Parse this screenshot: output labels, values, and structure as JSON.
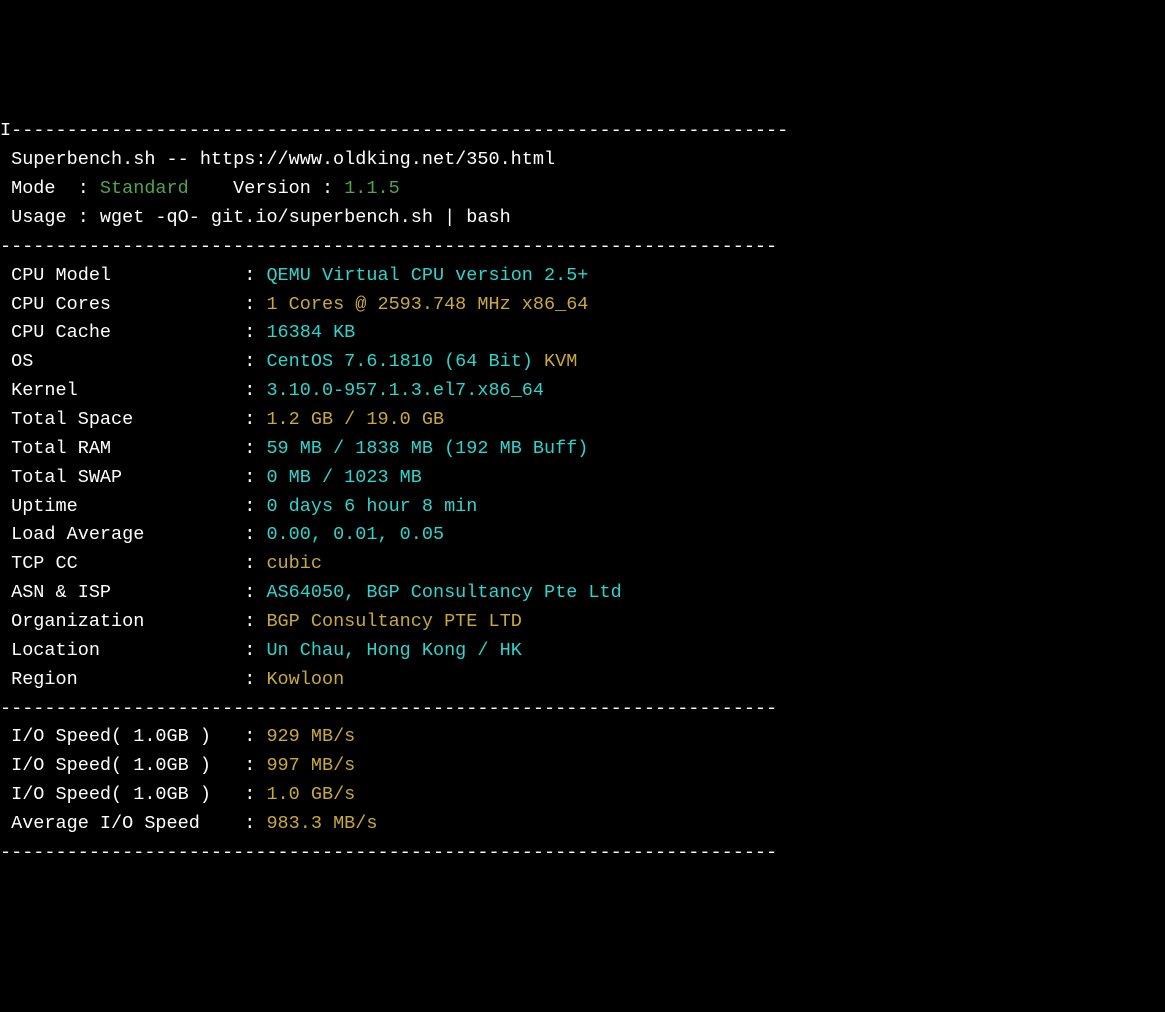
{
  "divider": "----------------------------------------------------------------------",
  "header": {
    "title_line": " Superbench.sh -- https://www.oldking.net/350.html",
    "mode_label": " Mode  : ",
    "mode_value": "Standard",
    "version_label": "    Version : ",
    "version_value": "1.1.5",
    "usage": " Usage : wget -qO- git.io/superbench.sh | bash"
  },
  "sysinfo": [
    {
      "label": " CPU Model            : ",
      "value": "QEMU Virtual CPU version 2.5+",
      "color": "cyan"
    },
    {
      "label": " CPU Cores            : ",
      "value": "1 Cores @ 2593.748 MHz x86_64",
      "color": "yellow"
    },
    {
      "label": " CPU Cache            : ",
      "value": "16384 KB",
      "color": "cyan"
    },
    {
      "label": " OS                   : ",
      "value": "CentOS 7.6.1810 (64 Bit)",
      "color": "cyan",
      "suffix": " KVM",
      "suffix_color": "yellow"
    },
    {
      "label": " Kernel               : ",
      "value": "3.10.0-957.1.3.el7.x86_64",
      "color": "cyan"
    },
    {
      "label": " Total Space          : ",
      "value": "1.2 GB / 19.0 GB",
      "color": "yellow"
    },
    {
      "label": " Total RAM            : ",
      "value": "59 MB / 1838 MB (192 MB Buff)",
      "color": "cyan"
    },
    {
      "label": " Total SWAP           : ",
      "value": "0 MB / 1023 MB",
      "color": "cyan"
    },
    {
      "label": " Uptime               : ",
      "value": "0 days 6 hour 8 min",
      "color": "cyan"
    },
    {
      "label": " Load Average         : ",
      "value": "0.00, 0.01, 0.05",
      "color": "cyan"
    },
    {
      "label": " TCP CC               : ",
      "value": "cubic",
      "color": "yellow"
    },
    {
      "label": " ASN & ISP            : ",
      "value": "AS64050, BGP Consultancy Pte Ltd",
      "color": "cyan"
    },
    {
      "label": " Organization         : ",
      "value": "BGP Consultancy PTE LTD",
      "color": "yellow"
    },
    {
      "label": " Location             : ",
      "value": "Un Chau, Hong Kong / HK",
      "color": "cyan"
    },
    {
      "label": " Region               : ",
      "value": "Kowloon",
      "color": "yellow"
    }
  ],
  "io": [
    {
      "label": " I/O Speed( 1.0GB )   : ",
      "value": "929 MB/s"
    },
    {
      "label": " I/O Speed( 1.0GB )   : ",
      "value": "997 MB/s"
    },
    {
      "label": " I/O Speed( 1.0GB )   : ",
      "value": "1.0 GB/s"
    },
    {
      "label": " Average I/O Speed    : ",
      "value": "983.3 MB/s"
    }
  ],
  "cursor_char": "I"
}
